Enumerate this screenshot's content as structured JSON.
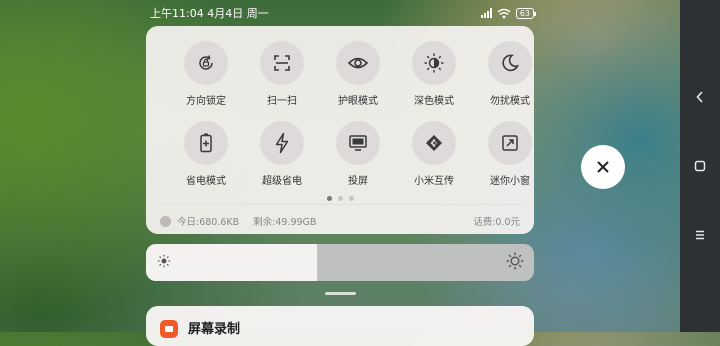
{
  "status_bar": {
    "time": "上午11:04",
    "date": "4月4日",
    "weekday": "周一",
    "signal_icon": "signal-icon",
    "wifi_icon": "wifi-icon",
    "battery": "63"
  },
  "toggles": [
    {
      "id": "rotation-lock",
      "label": "方向锁定",
      "icon": "rotation-lock-icon"
    },
    {
      "id": "scan",
      "label": "扫一扫",
      "icon": "scan-icon"
    },
    {
      "id": "eye-care",
      "label": "护眼模式",
      "icon": "eye-icon"
    },
    {
      "id": "dark-mode",
      "label": "深色模式",
      "icon": "sun-moon-icon"
    },
    {
      "id": "dnd",
      "label": "勿扰模式",
      "icon": "moon-icon"
    },
    {
      "id": "battery-saver",
      "label": "省电模式",
      "icon": "battery-plus-icon"
    },
    {
      "id": "ultra-saver",
      "label": "超级省电",
      "icon": "lightning-icon"
    },
    {
      "id": "cast",
      "label": "投屏",
      "icon": "monitor-icon"
    },
    {
      "id": "mi-share",
      "label": "小米互传",
      "icon": "mi-share-icon"
    },
    {
      "id": "mini-window",
      "label": "迷你小窗",
      "icon": "mini-window-icon"
    }
  ],
  "pager": {
    "pages": 3,
    "current": 1
  },
  "usage": {
    "today": "今日:680.6KB",
    "remaining": "剩余:49.99GB",
    "fee": "话费:0.0元"
  },
  "brightness": {
    "level": 0.44,
    "low_icon": "brightness-low-icon",
    "high_icon": "brightness-high-icon"
  },
  "notification": {
    "app_title": "屏幕录制"
  },
  "close_icon": "close-icon",
  "nav": [
    "back-icon",
    "home-icon",
    "menu-icon"
  ],
  "colors": {
    "panel": "#f6f3f2",
    "tile": "#dddad9",
    "notif_icon": "#f05a28",
    "navbar": "#2e3133"
  }
}
